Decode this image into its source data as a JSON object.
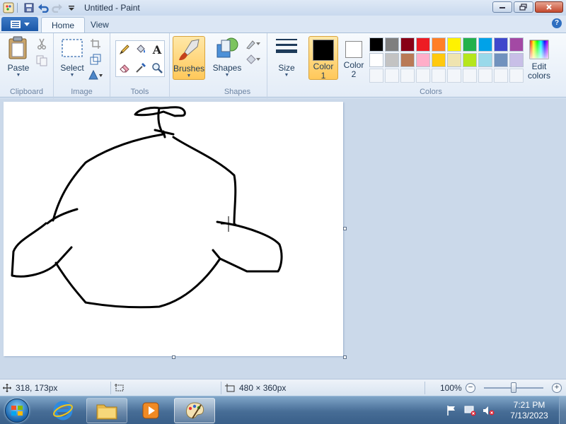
{
  "window": {
    "title": "Untitled - Paint"
  },
  "tabs": {
    "home": "Home",
    "view": "View"
  },
  "clipboard": {
    "group_label": "Clipboard",
    "paste_label": "Paste"
  },
  "image": {
    "group_label": "Image",
    "select_label": "Select"
  },
  "tools": {
    "group_label": "Tools"
  },
  "brushes": {
    "label": "Brushes"
  },
  "shapes": {
    "group_label": "Shapes",
    "label": "Shapes"
  },
  "size": {
    "label": "Size"
  },
  "colors": {
    "group_label": "Colors",
    "color1_label": "Color",
    "color1_num": "1",
    "color2_label": "Color",
    "color2_num": "2",
    "edit_label": "Edit",
    "edit_label2": "colors",
    "color1_value": "#000000",
    "color2_value": "#ffffff",
    "palette_row1": [
      "#000000",
      "#7f7f7f",
      "#880015",
      "#ed1c24",
      "#ff7f27",
      "#fff200",
      "#22b14c",
      "#00a2e8",
      "#3f48cc",
      "#a349a4"
    ],
    "palette_row2": [
      "#ffffff",
      "#c3c3c3",
      "#b97a57",
      "#ffaec9",
      "#ffc90e",
      "#efe4b0",
      "#b5e61d",
      "#99d9ea",
      "#7092be",
      "#c8bfe7"
    ]
  },
  "status": {
    "cursor_pos": "318, 173px",
    "canvas_size": "480 × 360px",
    "zoom": "100%",
    "zoom_value_percent": 100
  },
  "taskbar": {
    "time": "7:21 PM",
    "date": "7/13/2023"
  }
}
